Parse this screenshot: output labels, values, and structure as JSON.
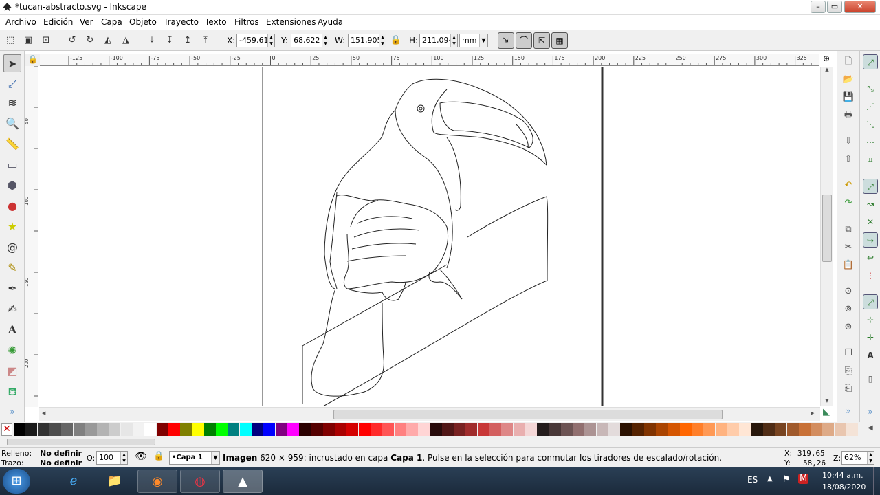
{
  "window": {
    "title": "*tucan-abstracto.svg - Inkscape",
    "min": "–",
    "max": "▭",
    "close": "✕"
  },
  "menu": [
    "Archivo",
    "Edición",
    "Ver",
    "Capa",
    "Objeto",
    "Trayecto",
    "Texto",
    "Filtros",
    "Extensiones",
    "Ayuda"
  ],
  "controls": {
    "x_label": "X:",
    "x_value": "-459,610",
    "y_label": "Y:",
    "y_value": "68,622",
    "w_label": "W:",
    "w_value": "151,905",
    "h_label": "H:",
    "h_value": "211,094",
    "unit": "mm"
  },
  "ruler": {
    "top_ticks": [
      "-125",
      "-100",
      "-75",
      "-50",
      "-25",
      "0",
      "25",
      "50",
      "75",
      "100",
      "125",
      "150",
      "175",
      "200",
      "225",
      "250",
      "275",
      "300",
      "325"
    ],
    "left_ticks": [
      "50",
      "100",
      "150",
      "200"
    ]
  },
  "tools": [
    "select-icon",
    "node-icon",
    "tweak-icon",
    "zoom-icon",
    "measure-icon",
    "rect-icon",
    "box3d-icon",
    "ellipse-icon",
    "star-icon",
    "spiral-icon",
    "pencil-icon",
    "pen-icon",
    "calligraphy-icon",
    "text-icon",
    "spray-icon",
    "eraser-icon",
    "paint-bucket-icon"
  ],
  "palette": [
    "#000000",
    "#1a1a1a",
    "#333333",
    "#4d4d4d",
    "#666666",
    "#808080",
    "#999999",
    "#b3b3b3",
    "#cccccc",
    "#e6e6e6",
    "#f2f2f2",
    "#ffffff",
    "#800000",
    "#ff0000",
    "#808000",
    "#ffff00",
    "#008000",
    "#00ff00",
    "#008080",
    "#00ffff",
    "#000080",
    "#0000ff",
    "#800080",
    "#ff00ff",
    "#2b0000",
    "#550000",
    "#800000",
    "#aa0000",
    "#d40000",
    "#ff0000",
    "#ff2a2a",
    "#ff5555",
    "#ff8080",
    "#ffaaaa",
    "#ffd5d5",
    "#280b0b",
    "#501616",
    "#782121",
    "#a02c2c",
    "#c83737",
    "#d35f5f",
    "#de8787",
    "#e9afaf",
    "#f4d7d7",
    "#241c1c",
    "#483737",
    "#6c5353",
    "#916f6f",
    "#ac9393",
    "#c8b7b7",
    "#e3dbdb",
    "#2b1100",
    "#552200",
    "#803300",
    "#aa4400",
    "#d45500",
    "#ff6600",
    "#ff7f2a",
    "#ff9955",
    "#ffb380",
    "#ffccaa",
    "#ffe6d5",
    "#28170b",
    "#502d16",
    "#784421",
    "#a05a2c",
    "#c87137",
    "#d38d5f",
    "#deaa87",
    "#e9c6af",
    "#f4e3d7"
  ],
  "status": {
    "fill_label": "Relleno:",
    "fill_value": "No definir",
    "stroke_label": "Trazo:",
    "stroke_value": "No definir",
    "opacity_label": "O:",
    "opacity_value": "100",
    "layer": "•Capa 1",
    "msg_bold": "Imagen",
    "msg_text1": " 620 × 959: incrustado en capa ",
    "msg_layer": "Capa 1",
    "msg_text2": ". Pulse en la selección para conmutar los tiradores de escalado/rotación.",
    "coord_x_label": "X:",
    "coord_x": "319,65",
    "coord_y_label": "Y:",
    "coord_y": "58,26",
    "zoom_label": "Z:",
    "zoom": "62%"
  },
  "taskbar": {
    "lang": "ES",
    "time": "10:44 a.m.",
    "date": "18/08/2020"
  }
}
